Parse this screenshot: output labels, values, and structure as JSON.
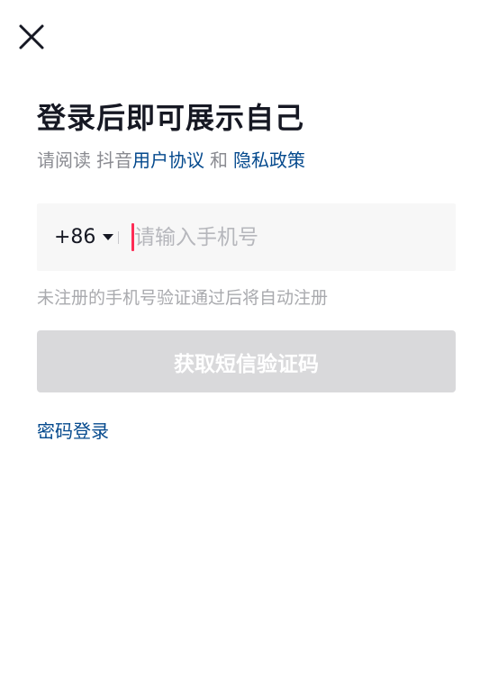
{
  "header": {
    "close_icon": "close-icon"
  },
  "title": "登录后即可展示自己",
  "agreement": {
    "prefix": "请阅读",
    "app_name": "抖音",
    "user_agreement": "用户协议",
    "and": "和",
    "privacy_policy": "隐私政策"
  },
  "phone": {
    "country_code": "+86",
    "placeholder": "请输入手机号",
    "value": ""
  },
  "hint": "未注册的手机号验证通过后将自动注册",
  "get_code_button": {
    "label": "获取短信验证码",
    "enabled": false
  },
  "password_login_label": "密码登录",
  "colors": {
    "link": "#04498d",
    "title": "#161823",
    "secondary_text": "#8a8b91",
    "disabled_button": "#d9d9db",
    "cursor": "#fe2c55"
  }
}
